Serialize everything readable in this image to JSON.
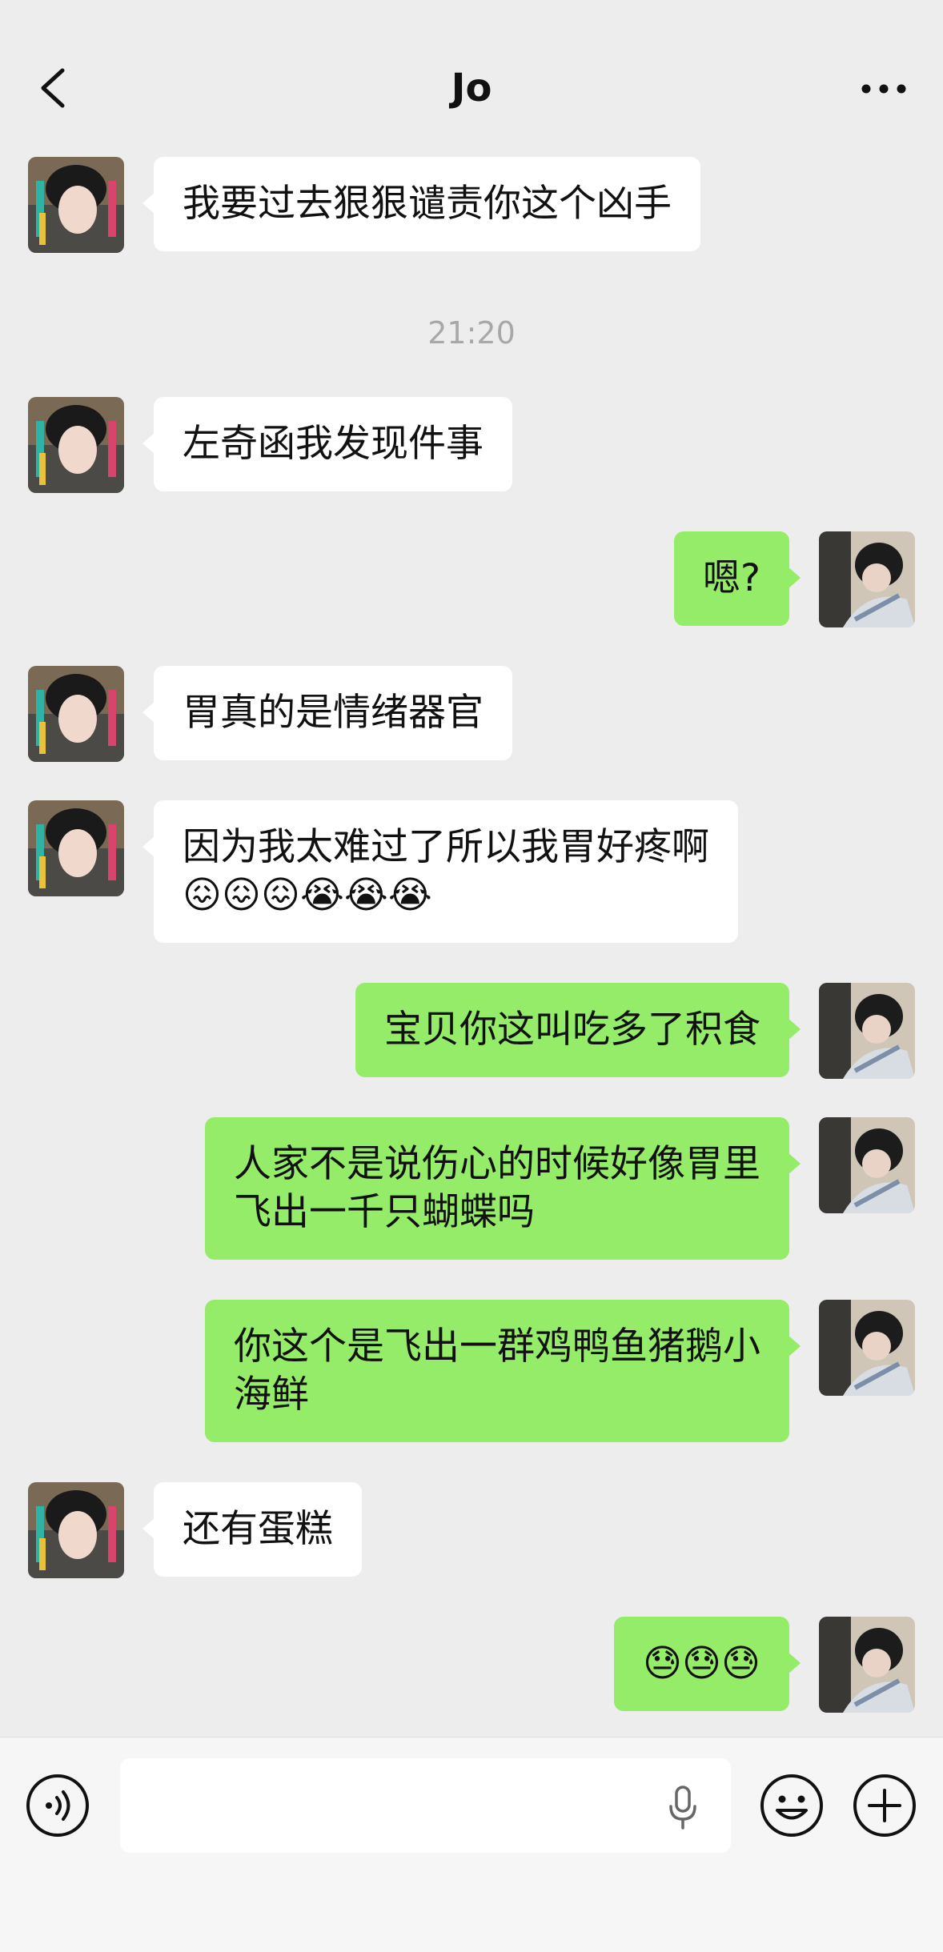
{
  "header": {
    "title": "Jo"
  },
  "chat": {
    "timestamp": "21:20",
    "messages": [
      {
        "side": "in",
        "text": "我要过去狠狠谴责你这个凶手"
      },
      {
        "side": "in",
        "text": "左奇函我发现件事"
      },
      {
        "side": "out",
        "text": "嗯?"
      },
      {
        "side": "in",
        "text": "胃真的是情绪器官"
      },
      {
        "side": "in",
        "text": "因为我太难过了所以我胃好疼啊\n😖😖😖😭😭😭"
      },
      {
        "side": "out",
        "text": "宝贝你这叫吃多了积食"
      },
      {
        "side": "out",
        "text": "人家不是说伤心的时候好像胃里\n飞出一千只蝴蝶吗"
      },
      {
        "side": "out",
        "text": "你这个是飞出一群鸡鸭鱼猪鹅小\n海鲜"
      },
      {
        "side": "in",
        "text": "还有蛋糕"
      },
      {
        "side": "out",
        "text": "😓😓😓"
      }
    ]
  },
  "icons": {
    "back": "chevron-left-icon",
    "more": "more-dots-icon",
    "voice": "voice-icon",
    "mic": "microphone-icon",
    "emoji": "emoji-icon",
    "plus": "plus-icon"
  },
  "colors": {
    "background": "#ededed",
    "incoming_bubble": "#ffffff",
    "outgoing_bubble": "#95ec69",
    "timestamp": "#a8a8a8"
  }
}
